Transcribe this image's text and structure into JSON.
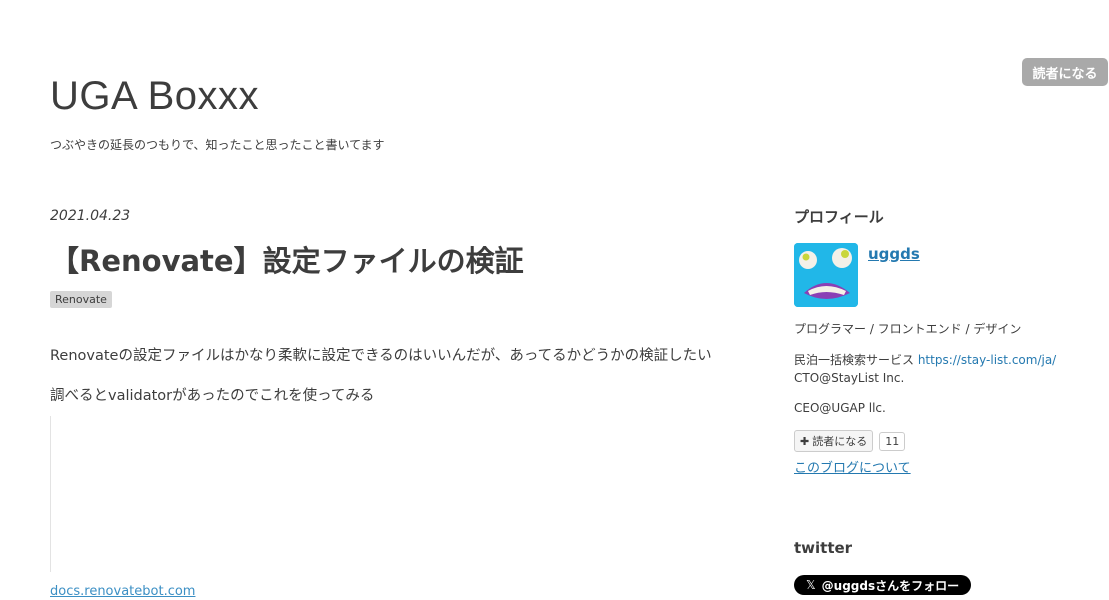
{
  "header": {
    "subscribe_label": "読者になる",
    "title": "UGA Boxxx",
    "description": "つぶやきの延長のつもりで、知ったこと思ったこと書いてます"
  },
  "entry": {
    "date": "2021.04.23",
    "title": "【Renovate】設定ファイルの検証",
    "category": "Renovate",
    "paragraphs": [
      "Renovateの設定ファイルはかなり柔軟に設定できるのはいいんだが、あってるかどうかの検証したい",
      "調べるとvalidatorがあったのでこれを使ってみる"
    ],
    "embed_link": "docs.renovatebot.com"
  },
  "sidebar": {
    "profile_heading": "プロフィール",
    "username": "uggds",
    "bio": "プログラマー / フロントエンド / デザイン",
    "line1_text": "民泊一括検索サービス ",
    "line1_link": "https://stay-list.com/ja/",
    "line2": "CTO@StayList Inc.",
    "line3": "CEO@UGAP llc.",
    "subscribe_label": "読者になる",
    "subscriber_count": "11",
    "about_link": "このブログについて",
    "twitter_heading": "twitter",
    "follow_label": "@uggdsさんをフォロー"
  }
}
